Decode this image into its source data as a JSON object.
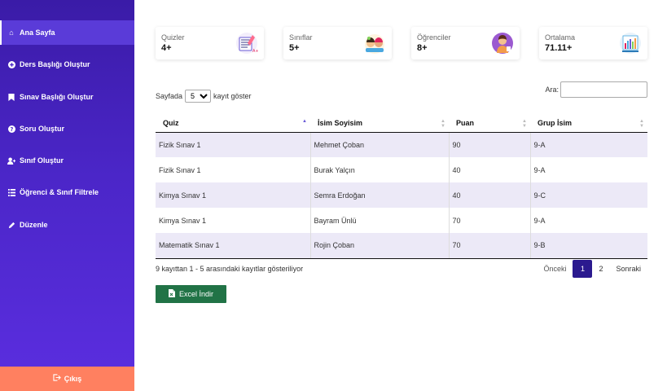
{
  "sidebar": {
    "items": [
      {
        "label": "Ana Sayfa",
        "icon": "home-icon",
        "glyph": "⌂"
      },
      {
        "label": "Ders Başlığı Oluştur",
        "icon": "plus-circle-icon",
        "glyph": "⊕"
      },
      {
        "label": "Sınav Başlığı Oluştur",
        "icon": "bookmark-icon",
        "glyph": "🔖"
      },
      {
        "label": "Soru Oluştur",
        "icon": "question-circle-icon",
        "glyph": "?"
      },
      {
        "label": "Sınıf Oluştur",
        "icon": "user-plus-icon",
        "glyph": "👤"
      },
      {
        "label": "Öğrenci & Sınıf Filtrele",
        "icon": "list-icon",
        "glyph": "☰"
      },
      {
        "label": "Düzenle",
        "icon": "pencil-icon",
        "glyph": "✎"
      }
    ],
    "logout_label": "Çıkış"
  },
  "stats": [
    {
      "label": "Quizler",
      "value": "4+",
      "icon": "quiz-illustration"
    },
    {
      "label": "Sınıflar",
      "value": "5+",
      "icon": "classroom-illustration"
    },
    {
      "label": "Öğrenciler",
      "value": "8+",
      "icon": "student-illustration"
    },
    {
      "label": "Ortalama",
      "value": "71.11+",
      "icon": "average-chart-illustration"
    }
  ],
  "table_controls": {
    "length_prefix": "Sayfada",
    "length_value": "5",
    "length_suffix": "kayıt göster",
    "search_label": "Ara:",
    "search_value": ""
  },
  "table": {
    "columns": [
      "Quiz",
      "İsim Soyisim",
      "Puan",
      "Grup İsim"
    ],
    "rows": [
      [
        "Fizik Sınav 1",
        "Mehmet Çoban",
        "90",
        "9-A"
      ],
      [
        "Fizik Sınav 1",
        "Burak Yalçın",
        "40",
        "9-A"
      ],
      [
        "Kimya Sınav 1",
        "Semra Erdoğan",
        "40",
        "9-C"
      ],
      [
        "Kimya Sınav 1",
        "Bayram Ünlü",
        "70",
        "9-A"
      ],
      [
        "Matematik Sınav 1",
        "Rojin Çoban",
        "70",
        "9-B"
      ]
    ]
  },
  "footer": {
    "info": "9 kayıttan 1 - 5 arasındaki kayıtlar gösteriliyor",
    "prev": "Önceki",
    "pages": [
      "1",
      "2"
    ],
    "current_page": "1",
    "next": "Sonraki"
  },
  "excel_label": "Excel İndir",
  "colors": {
    "accent": "#4b26c8",
    "logout": "#ff8060",
    "excel": "#217346",
    "row_stripe": "#ece9f7"
  }
}
